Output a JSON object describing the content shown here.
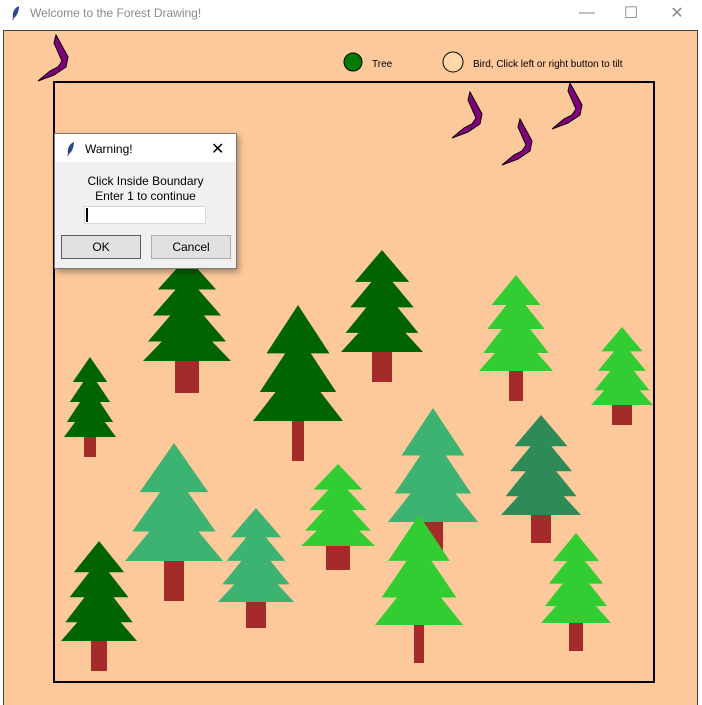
{
  "window": {
    "title": "Welcome to the Forest Drawing!",
    "minimize": "—",
    "maximize": "☐",
    "close": "✕"
  },
  "legend": {
    "tree_label": "Tree",
    "bird_label": "Bird, Click left or right button to tilt",
    "tree_color": "#007a00",
    "bird_color": "#ffd7a8"
  },
  "colors": {
    "canvas_bg": "#fdc99a",
    "trunk": "#a52a2a",
    "bird": "#800080",
    "tree_dark": "#006400",
    "tree_lime": "#32cd32",
    "tree_medium": "#3cb371",
    "tree_sea": "#2e8b57"
  },
  "dialog": {
    "title": "Warning!",
    "close": "✕",
    "message_line1": "Click Inside Boundary",
    "message_line2": "Enter 1 to continue",
    "input_value": "",
    "ok_label": "OK",
    "cancel_label": "Cancel"
  }
}
